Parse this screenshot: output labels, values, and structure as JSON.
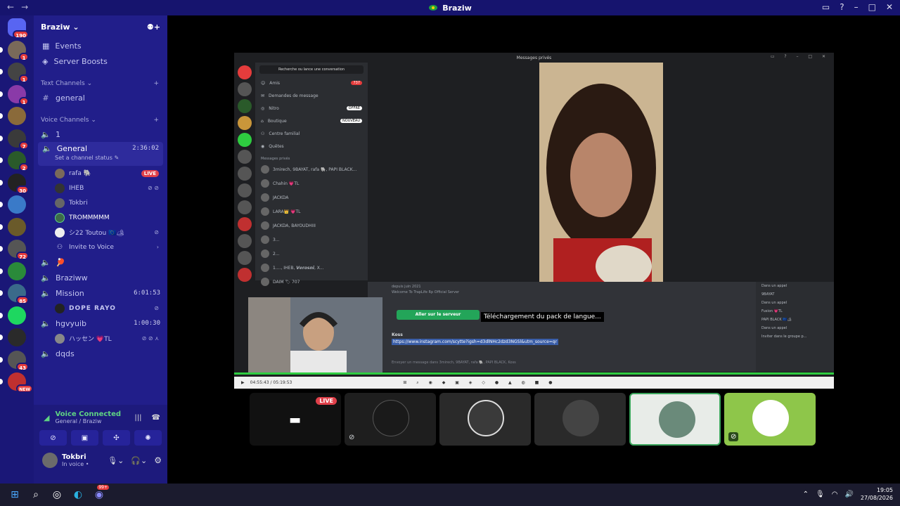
{
  "window": {
    "title": "Braziw",
    "back": "←",
    "forward": "→"
  },
  "guilds": [
    {
      "badge": "190"
    },
    {
      "badge": "1"
    },
    {
      "badge": "1"
    },
    {
      "badge": "1"
    },
    {
      "badge": ""
    },
    {
      "badge": "7"
    },
    {
      "badge": "2"
    },
    {
      "badge": "30"
    },
    {
      "badge": ""
    },
    {
      "badge": ""
    },
    {
      "badge": "72"
    },
    {
      "badge": ""
    },
    {
      "badge": "85"
    },
    {
      "badge": ""
    },
    {
      "badge": ""
    },
    {
      "badge": "43"
    },
    {
      "badge": "NEW"
    }
  ],
  "server": {
    "name": "Braziw"
  },
  "nav": {
    "events": "Events",
    "boosts": "Server Boosts"
  },
  "text_channels": {
    "header": "Text Channels",
    "items": [
      "general"
    ]
  },
  "voice_channels": {
    "header": "Voice Channels",
    "ch1": "1",
    "general": {
      "name": "General",
      "timer": "2:36:02",
      "status": "Set a channel status"
    },
    "users": [
      {
        "name": "rafa 🐘",
        "live": "LIVE"
      },
      {
        "name": "IHEB"
      },
      {
        "name": "Tokbri"
      },
      {
        "name": "TROMMMMM"
      },
      {
        "name": "シ22 Toutou 🇪🇺🏕"
      }
    ],
    "invite": "Invite to Voice",
    "ch_flag": "🏓",
    "braziww": "Braziww",
    "mission": {
      "name": "Mission",
      "timer": "6:01:53",
      "user": "DOPE RAYO"
    },
    "hgvyuib": {
      "name": "hgvyuib",
      "timer": "1:00:30",
      "user": "ハッセン 💗TL"
    },
    "dqds": "dqds"
  },
  "voice_connected": {
    "title": "Voice Connected",
    "sub": "General / Braziw"
  },
  "user": {
    "name": "Tokbri",
    "status": "In voice •"
  },
  "shot": {
    "title": "Messages privés",
    "search": "Recherche ou lance une conversation",
    "items": [
      {
        "label": "Amis",
        "badge": "737"
      },
      {
        "label": "Demandes de message",
        "badge": ""
      },
      {
        "label": "Nitro",
        "badge": "OFFRE"
      },
      {
        "label": "Boutique",
        "badge": "NOUVEAU"
      },
      {
        "label": "Centre familial",
        "badge": ""
      },
      {
        "label": "Quêtes",
        "badge": ""
      }
    ],
    "dm_header": "Messages privés",
    "dms": [
      "3mirech, 9BAYAT, rafa 🐘, PAPI BLACK...",
      "Chahin 💗TL",
      "JACKDA",
      "LARA👑 💗TL",
      "JACKDA, BAYOUDHIII",
      "3...",
      "2...",
      "1...., IHEB, 𝙑𝙚𝙧𝙤𝙨𝙣𝙞, X...",
      "DAIM 🏷 707"
    ],
    "server_info": "depuis juin 2021",
    "welcome": "Welcome To TrapLife Rp Official Server",
    "goto_btn": "Aller sur le serveur",
    "author": "Koss",
    "link": "https://www.instagram.com/scytte?igsh=d3dlNHc2dzd3NGSl&utm_source=qr",
    "input": "Envoyer un message dans 3mirech, 9BAYAT, rafa 🐘, PAPI BLACK, Koss",
    "right": [
      "Dans un appel",
      "9BAYAT",
      "Dans un appel",
      "Fusion 💗TL",
      "PAPI BLACK 🇪🇺🏕",
      "Dans un appel",
      "Inviter dans le groupe p..."
    ],
    "tooltip": "Téléchargement du pack de langue...",
    "time": "04:55:43 / 05:19:53"
  },
  "tiles": [
    {
      "live": "LIVE"
    },
    {},
    {},
    {},
    {},
    {}
  ],
  "taskbar": {
    "time": "19:05",
    "date": "27/08/2026",
    "discord_badge": "99+"
  }
}
